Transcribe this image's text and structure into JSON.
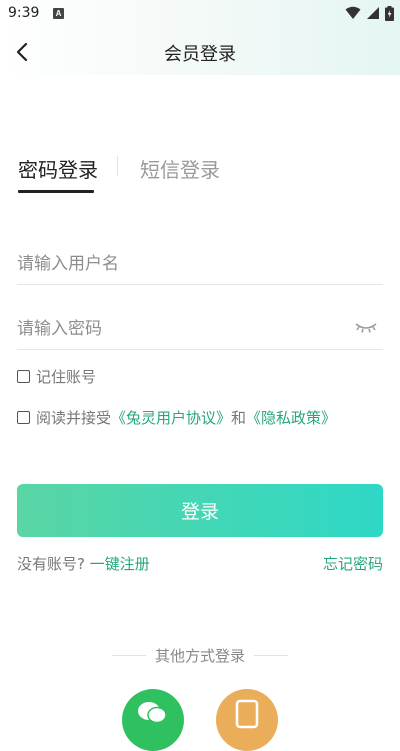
{
  "status_bar": {
    "time": "9:39",
    "notification_icon": "A"
  },
  "header": {
    "title": "会员登录"
  },
  "tabs": [
    {
      "label": "密码登录",
      "active": true
    },
    {
      "label": "短信登录",
      "active": false
    }
  ],
  "form": {
    "username_placeholder": "请输入用户名",
    "password_placeholder": "请输入密码",
    "remember_label": "记住账号",
    "agree_prefix": "阅读并接受",
    "agree_link_1": "《兔灵用户协议》",
    "agree_and": "和",
    "agree_link_2": "《隐私政策》"
  },
  "login_button": "登录",
  "register": {
    "prompt": "没有账号?",
    "link": "一键注册"
  },
  "forgot_password": "忘记密码",
  "other_login": {
    "title": "其他方式登录"
  },
  "colors": {
    "accent": "#26a878",
    "button_gradient_start": "#5ad5a4",
    "button_gradient_end": "#2ed8c6",
    "wechat": "#2fc160",
    "phone": "#eaae5a"
  }
}
